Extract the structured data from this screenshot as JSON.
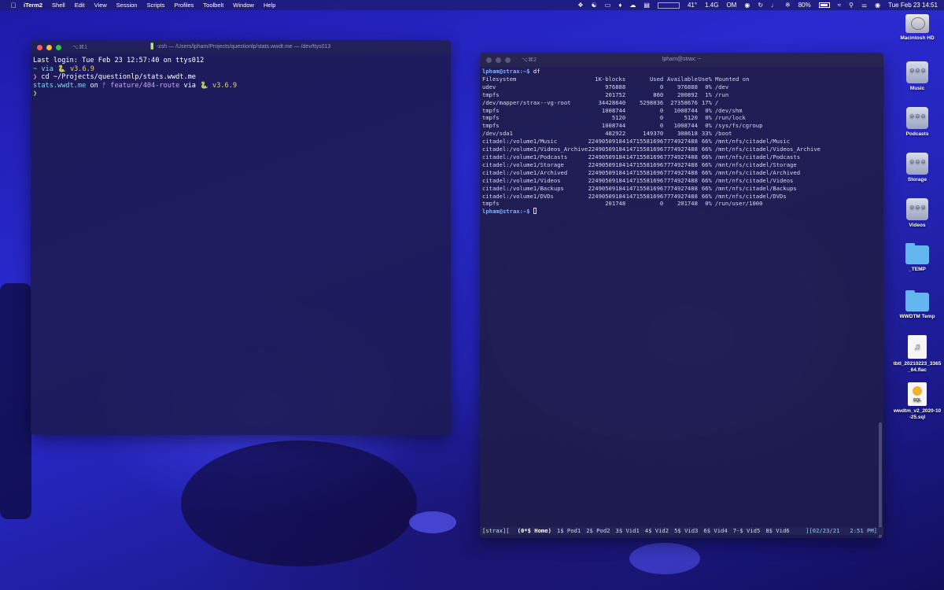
{
  "menubar": {
    "app": "iTerm2",
    "items": [
      "Shell",
      "Edit",
      "View",
      "Session",
      "Scripts",
      "Profiles",
      "Toolbelt",
      "Window",
      "Help"
    ],
    "status": {
      "temp": "41°",
      "mem": "1.4G",
      "mem_unit": "OM",
      "battery": "80%",
      "datetime": "Tue Feb 23  14:51"
    }
  },
  "window1": {
    "shortcut": "⌥⌘1",
    "title": "-zsh — /Users/lpham/Projects/questionlp/stats.wwdt.me — /dev/ttys013",
    "lines": {
      "login": "Last login: Tue Feb 23 12:57:40 on ttys012",
      "via1_prefix": "~ via ",
      "via1_version": "v3.6.9",
      "cmd": "cd ~/Projects/questionlp/stats.wwdt.me",
      "dir": "stats.wwdt.me",
      "on": " on ",
      "branch": "ᚠ feature/404-route",
      "via2_prefix": " via ",
      "via2_version": "v3.6.9",
      "prompt": "❯",
      "python_glyph": "🐍"
    }
  },
  "window2": {
    "shortcut": "⌥⌘2",
    "title": "lpham@strax: ~",
    "prompt": "lpham@strax:~$",
    "command": "df",
    "headers": [
      "Filesystem",
      "1K-blocks",
      "Used",
      "Available",
      "Use%",
      "Mounted on"
    ],
    "rows": [
      [
        "udev",
        "976888",
        "0",
        "976888",
        "0%",
        "/dev"
      ],
      [
        "tmpfs",
        "201752",
        "860",
        "200892",
        "1%",
        "/run"
      ],
      [
        "/dev/mapper/strax--vg-root",
        "34428640",
        "5298036",
        "27358676",
        "17%",
        "/"
      ],
      [
        "tmpfs",
        "1008744",
        "0",
        "1008744",
        "0%",
        "/dev/shm"
      ],
      [
        "tmpfs",
        "5120",
        "0",
        "5120",
        "0%",
        "/run/lock"
      ],
      [
        "tmpfs",
        "1008744",
        "0",
        "1008744",
        "0%",
        "/sys/fs/cgroup"
      ],
      [
        "/dev/sda1",
        "482922",
        "149370",
        "308618",
        "33%",
        "/boot"
      ],
      [
        "citadel:/volume1/Music",
        "22490509184",
        "14715581696",
        "7774927488",
        "66%",
        "/mnt/nfs/citadel/Music"
      ],
      [
        "citadel:/volume1/Videos_Archive",
        "22490509184",
        "14715581696",
        "7774927488",
        "66%",
        "/mnt/nfs/citadel/Videos_Archive"
      ],
      [
        "citadel:/volume1/Podcasts",
        "22490509184",
        "14715581696",
        "7774927488",
        "66%",
        "/mnt/nfs/citadel/Podcasts"
      ],
      [
        "citadel:/volume1/Storage",
        "22490509184",
        "14715581696",
        "7774927488",
        "66%",
        "/mnt/nfs/citadel/Storage"
      ],
      [
        "citadel:/volume1/Archived",
        "22490509184",
        "14715581696",
        "7774927488",
        "66%",
        "/mnt/nfs/citadel/Archived"
      ],
      [
        "citadel:/volume1/Videos",
        "22490509184",
        "14715581696",
        "7774927488",
        "66%",
        "/mnt/nfs/citadel/Videos"
      ],
      [
        "citadel:/volume1/Backups",
        "22490509184",
        "14715581696",
        "7774927488",
        "66%",
        "/mnt/nfs/citadel/Backups"
      ],
      [
        "citadel:/volume1/DVDs",
        "22490509184",
        "14715581696",
        "7774927488",
        "66%",
        "/mnt/nfs/citadel/DVDs"
      ],
      [
        "tmpfs",
        "201748",
        "0",
        "201748",
        "0%",
        "/run/user/1000"
      ]
    ],
    "statusbar": {
      "session": "[strax][",
      "windows": [
        "(0*$ Home)",
        "1$ Pod1",
        "2$ Pod2",
        "3$ Vid1",
        "4$ Vid2",
        "5$ Vid3",
        "6$ Vid4",
        "7-$ Vid5",
        "8$ Vid6"
      ],
      "right": "][02/23/21   2:51 PM]"
    }
  },
  "desktop_icons": [
    {
      "label": "Macintosh HD",
      "type": "hd"
    },
    {
      "label": "Music",
      "type": "nas"
    },
    {
      "label": "Podcasts",
      "type": "nas"
    },
    {
      "label": "Storage",
      "type": "nas"
    },
    {
      "label": "Videos",
      "type": "nas"
    },
    {
      "label": "_TEMP",
      "type": "folder"
    },
    {
      "label": "WWDTM Temp",
      "type": "folder"
    },
    {
      "label": "tbtl_20210223_3365_64.flac",
      "type": "audio"
    },
    {
      "label": "wwdtm_v2_2020-10-25.sql",
      "type": "sql",
      "badge": "SQL"
    }
  ],
  "colors": {
    "close": "#ff5f57",
    "minimize": "#febc2e",
    "zoom": "#28c840",
    "inactive_light": "#5a5878"
  }
}
